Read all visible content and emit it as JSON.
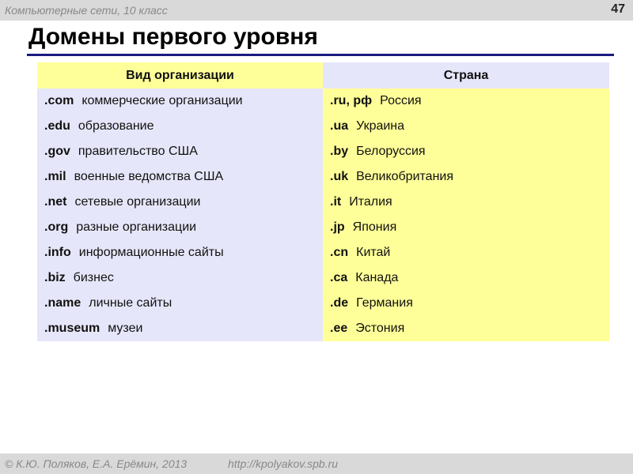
{
  "header": {
    "course": "Компьютерные сети, 10 класс",
    "slide_number": "47"
  },
  "title": "Домены первого уровня",
  "table": {
    "headers": [
      "Вид организации",
      "Страна"
    ],
    "rows": [
      {
        "org_code": ".com",
        "org_desc": "коммерческие организации",
        "country_code": ".ru, рф",
        "country": "Россия"
      },
      {
        "org_code": ".edu",
        "org_desc": "образование",
        "country_code": ".ua",
        "country": "Украина"
      },
      {
        "org_code": ".gov",
        "org_desc": "правительство США",
        "country_code": ".by",
        "country": "Белоруссия"
      },
      {
        "org_code": ".mil",
        "org_desc": "военные ведомства США",
        "country_code": ".uk",
        "country": "Великобритания"
      },
      {
        "org_code": ".net",
        "org_desc": "сетевые организации",
        "country_code": ".it",
        "country": "Италия"
      },
      {
        "org_code": ".org",
        "org_desc": "разные организации",
        "country_code": ".jp",
        "country": "Япония"
      },
      {
        "org_code": ".info",
        "org_desc": "информационные сайты",
        "country_code": ".cn",
        "country": "Китай"
      },
      {
        "org_code": ".biz",
        "org_desc": "бизнес",
        "country_code": ".ca",
        "country": "Канада"
      },
      {
        "org_code": ".name",
        "org_desc": "личные сайты",
        "country_code": ".de",
        "country": "Германия"
      },
      {
        "org_code": ".museum",
        "org_desc": "музеи",
        "country_code": ".ee",
        "country": "Эстония"
      }
    ]
  },
  "footer": {
    "copyright": "© К.Ю. Поляков, Е.А. Ерёмин, 2013",
    "url": "http://kpolyakov.spb.ru"
  }
}
